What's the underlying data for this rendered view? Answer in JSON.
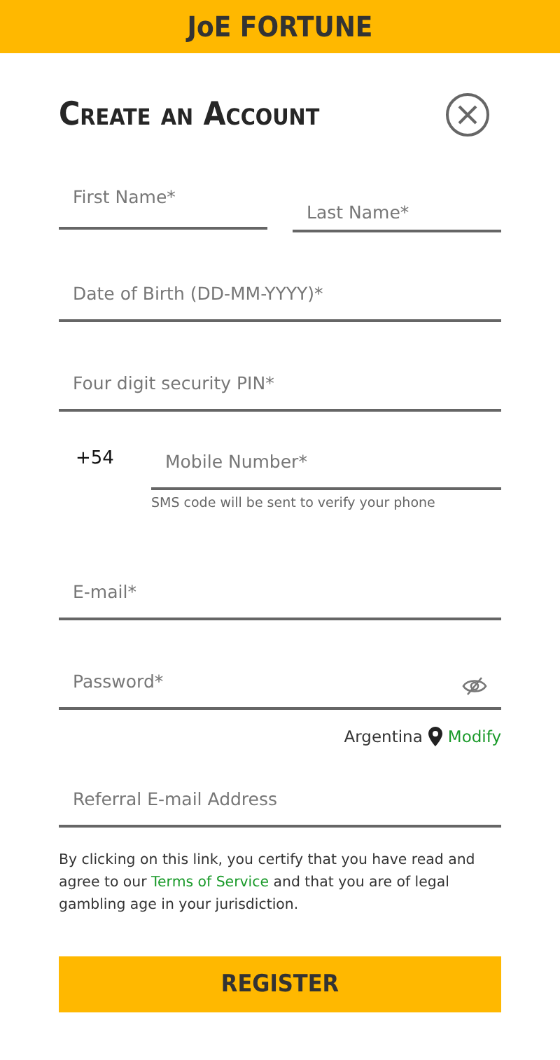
{
  "header": {
    "logo": "JoE FORTUNE"
  },
  "title": "Create an Account",
  "name_fields": [
    {
      "placeholder": "First Name*"
    },
    {
      "placeholder": "Last Name*"
    }
  ],
  "fields_top": [
    {
      "placeholder": "Date of Birth (DD-MM-YYYY)*"
    },
    {
      "placeholder": "Four digit security PIN*"
    }
  ],
  "phone": {
    "prefix": "+54",
    "placeholder": "Mobile Number*",
    "hint": "SMS code will be sent to verify your phone"
  },
  "email": {
    "placeholder": "E-mail*"
  },
  "password": {
    "placeholder": "Password*"
  },
  "location": {
    "country": "Argentina",
    "link": "Modify"
  },
  "referral": {
    "placeholder": "Referral E-mail Address"
  },
  "consent": {
    "before": "By clicking on this link, you certify that you have read and agree to our",
    "link": "Terms of Service",
    "after": "and that you are of legal gambling age in your jurisdiction."
  },
  "register_button": "REGISTER"
}
